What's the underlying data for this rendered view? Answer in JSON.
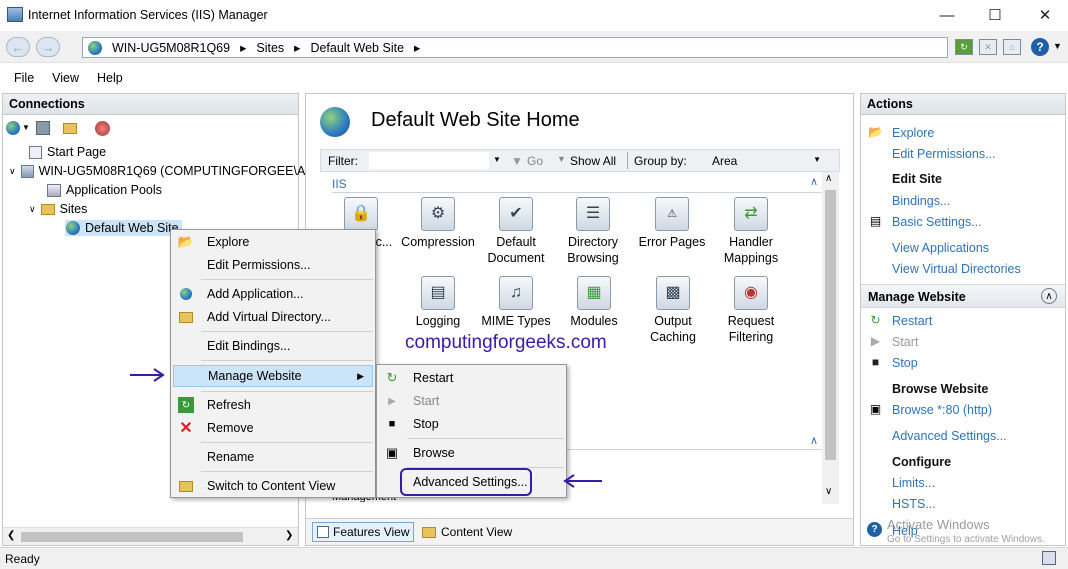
{
  "window": {
    "title": "Internet Information Services (IIS) Manager"
  },
  "address": {
    "crumbs": [
      "WIN-UG5M08R1Q69",
      "Sites",
      "Default Web Site"
    ]
  },
  "menu": [
    "File",
    "View",
    "Help"
  ],
  "connections": {
    "header": "Connections",
    "tree": {
      "start_page": "Start Page",
      "server": "WIN-UG5M08R1Q69 (COMPUTINGFORGEE\\A",
      "app_pools": "Application Pools",
      "sites": "Sites",
      "default_site": "Default Web Site"
    }
  },
  "center": {
    "title": "Default Web Site Home",
    "filter_label": "Filter:",
    "go_label": "Go",
    "show_all_label": "Show All",
    "group_by_label": "Group by:",
    "group_by_value": "Area",
    "section": "IIS",
    "features": [
      "Authentic...",
      "Compression",
      "Default Document",
      "Directory Browsing",
      "Error Pages",
      "Handler Mappings",
      "Logging",
      "MIME Types",
      "Modules",
      "Output Caching",
      "Request Filtering"
    ],
    "watermark": "computingforgeeks.com",
    "features_view_tab": "Features View",
    "content_view_tab": "Content View",
    "cut_text": "Management"
  },
  "context_menu": {
    "items": [
      "Explore",
      "Edit Permissions...",
      "Add Application...",
      "Add Virtual Directory...",
      "Edit Bindings...",
      "Manage Website",
      "Refresh",
      "Remove",
      "Rename",
      "Switch to Content View"
    ]
  },
  "submenu": {
    "items": [
      "Restart",
      "Start",
      "Stop",
      "Browse",
      "Advanced Settings..."
    ]
  },
  "actions": {
    "header": "Actions",
    "explore": "Explore",
    "edit_permissions": "Edit Permissions...",
    "edit_site": "Edit Site",
    "bindings": "Bindings...",
    "basic_settings": "Basic Settings...",
    "view_applications": "View Applications",
    "view_virtual_dirs": "View Virtual Directories",
    "manage_website": "Manage Website",
    "restart": "Restart",
    "start": "Start",
    "stop": "Stop",
    "browse_website": "Browse Website",
    "browse_80": "Browse *:80 (http)",
    "advanced_settings": "Advanced Settings...",
    "configure": "Configure",
    "limits": "Limits...",
    "hsts": "HSTS...",
    "help": "Help",
    "activate_title": "Activate Windows",
    "activate_sub": "Go to Settings to activate Windows."
  },
  "status": {
    "text": "Ready"
  },
  "colors": {
    "annotation": "#3a1aa8",
    "link": "#2d74b8",
    "selection": "#cce4f7"
  }
}
